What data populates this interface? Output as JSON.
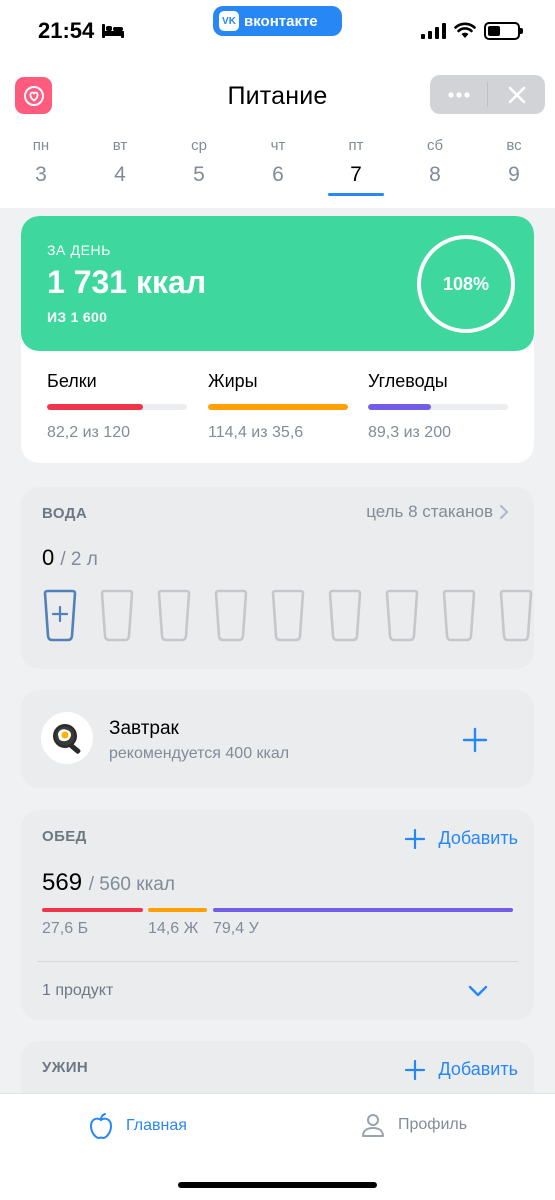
{
  "status_bar": {
    "time": "21:54",
    "app_pill": "вконтакте",
    "app_pill_logo": "VK"
  },
  "header": {
    "title": "Питание",
    "app_icon": "heart-icon",
    "menu_icon": "more-horizontal-icon",
    "close_icon": "close-icon"
  },
  "week": {
    "days": [
      {
        "name": "пн",
        "num": "3"
      },
      {
        "name": "вт",
        "num": "4"
      },
      {
        "name": "ср",
        "num": "5"
      },
      {
        "name": "чт",
        "num": "6"
      },
      {
        "name": "пт",
        "num": "7"
      },
      {
        "name": "сб",
        "num": "8"
      },
      {
        "name": "вс",
        "num": "9"
      }
    ],
    "selected_index": 4
  },
  "summary": {
    "label": "ЗА ДЕНЬ",
    "kcal": "1 731 ккал",
    "goal": "ИЗ 1 600",
    "percent": "108%",
    "accent_color": "#3ed89e",
    "macros": [
      {
        "name": "Белки",
        "value": "82,2 из 120",
        "fill": 0.685,
        "color": "#f0354a"
      },
      {
        "name": "Жиры",
        "value": "114,4 из 35,6",
        "fill": 1.0,
        "color": "#ffa000"
      },
      {
        "name": "Углеводы",
        "value": "89,3 из 200",
        "fill": 0.447,
        "color": "#735ce6"
      }
    ]
  },
  "water": {
    "heading": "ВОДА",
    "goal_text": "цель 8 стаканов",
    "amount": "0",
    "amount_total": "/ 2 л",
    "glasses_count": 9,
    "add_glass_icon": "plus-icon"
  },
  "breakfast": {
    "title": "Завтрак",
    "subtitle": "рекомендуется 400 ккал",
    "icon": "fried-egg-pan-icon"
  },
  "lunch": {
    "heading": "ОБЕД",
    "add_label": "Добавить",
    "kcal": "569",
    "kcal_total": "/ 560 ккал",
    "macros": [
      {
        "label": "27,6 Б",
        "color": "#f0354a"
      },
      {
        "label": "14,6 Ж",
        "color": "#ffa000"
      },
      {
        "label": "79,4 У",
        "color": "#735ce6"
      }
    ],
    "products": "1 продукт"
  },
  "dinner": {
    "heading": "УЖИН",
    "add_label": "Добавить"
  },
  "tabs": [
    {
      "label": "Главная",
      "icon": "apple-icon",
      "active": true
    },
    {
      "label": "Профиль",
      "icon": "user-icon",
      "active": false
    }
  ]
}
